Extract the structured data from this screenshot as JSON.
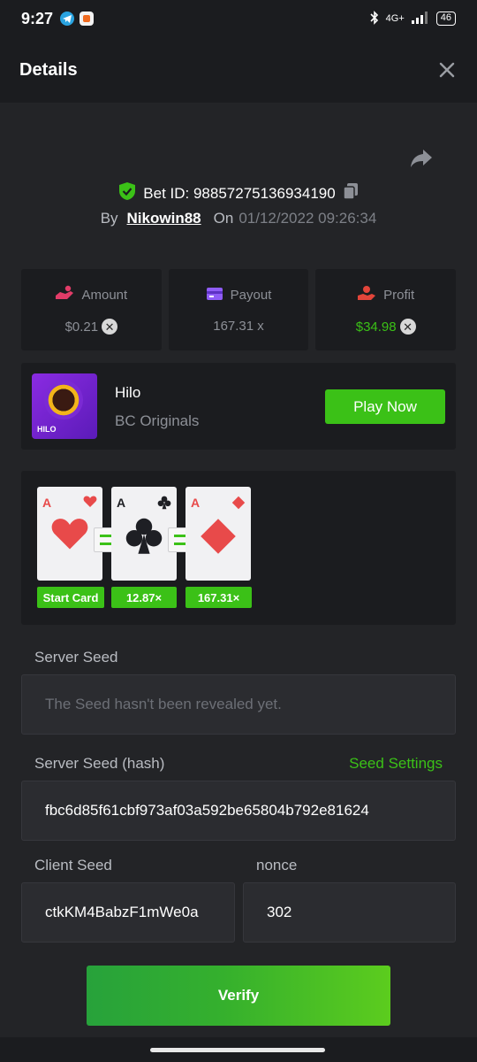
{
  "status_bar": {
    "time": "9:27",
    "network": "4G+",
    "battery": "46"
  },
  "header": {
    "title": "Details"
  },
  "bet": {
    "id_label": "Bet ID: 98857275136934190",
    "by_label": "By",
    "user": "Nikowin88",
    "on_label": "On",
    "date": "01/12/2022 09:26:34"
  },
  "stats": [
    {
      "label": "Amount",
      "value": "$0.21",
      "color": "#e23c68"
    },
    {
      "label": "Payout",
      "value": "167.31 x",
      "color": "#8f5cf7"
    },
    {
      "label": "Profit",
      "value": "$34.98",
      "color": "#e3453a"
    }
  ],
  "game": {
    "name": "Hilo",
    "provider": "BC Originals",
    "play_label": "Play Now",
    "thumb_tag": "HILO"
  },
  "hilo_cards": [
    {
      "rank": "A",
      "suit": "heart",
      "tag": "Start Card"
    },
    {
      "rank": "A",
      "suit": "club",
      "tag": "12.87×"
    },
    {
      "rank": "A",
      "suit": "diamond",
      "tag": "167.31×"
    }
  ],
  "seeds": {
    "server_seed_label": "Server Seed",
    "server_seed_placeholder": "The Seed hasn't been revealed yet.",
    "server_hash_label": "Server Seed (hash)",
    "seed_settings_label": "Seed Settings",
    "server_hash_value": "fbc6d85f61cbf973af03a592be65804b792e81624",
    "client_seed_label": "Client Seed",
    "client_seed_value": "ctkKM4BabzF1mWe0a",
    "nonce_label": "nonce",
    "nonce_value": "302"
  },
  "verify_label": "Verify",
  "colors": {
    "green": "#3bc117",
    "bg": "#232427",
    "panel": "#1b1c1f"
  }
}
